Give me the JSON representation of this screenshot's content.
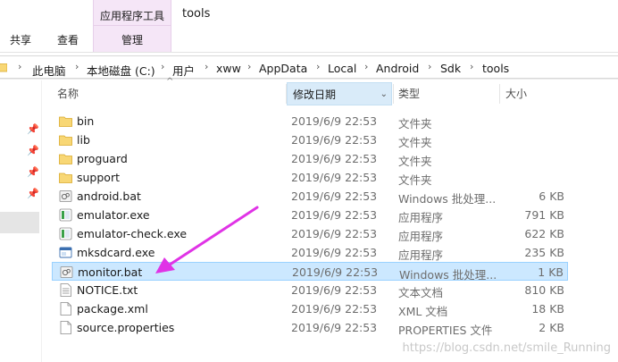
{
  "ribbon": {
    "tabs": [
      "共享",
      "查看"
    ],
    "context_group_title": "应用程序工具",
    "context_tab": "管理",
    "window_title": "tools"
  },
  "address": {
    "crumbs": [
      "此电脑",
      "本地磁盘 (C:)",
      "用户",
      "xww",
      "AppData",
      "Local",
      "Android",
      "Sdk",
      "tools"
    ]
  },
  "columns": {
    "name": "名称",
    "date": "修改日期",
    "type": "类型",
    "size": "大小"
  },
  "files": [
    {
      "name": "bin",
      "date": "2019/6/9 22:53",
      "type": "文件夹",
      "size": "",
      "icon": "folder-icon"
    },
    {
      "name": "lib",
      "date": "2019/6/9 22:53",
      "type": "文件夹",
      "size": "",
      "icon": "folder-icon"
    },
    {
      "name": "proguard",
      "date": "2019/6/9 22:53",
      "type": "文件夹",
      "size": "",
      "icon": "folder-icon"
    },
    {
      "name": "support",
      "date": "2019/6/9 22:53",
      "type": "文件夹",
      "size": "",
      "icon": "folder-icon"
    },
    {
      "name": "android.bat",
      "date": "2019/6/9 22:53",
      "type": "Windows 批处理...",
      "size": "6 KB",
      "icon": "batch-file-icon"
    },
    {
      "name": "emulator.exe",
      "date": "2019/6/9 22:53",
      "type": "应用程序",
      "size": "791 KB",
      "icon": "app-exe-icon"
    },
    {
      "name": "emulator-check.exe",
      "date": "2019/6/9 22:53",
      "type": "应用程序",
      "size": "622 KB",
      "icon": "app-exe-icon"
    },
    {
      "name": "mksdcard.exe",
      "date": "2019/6/9 22:53",
      "type": "应用程序",
      "size": "235 KB",
      "icon": "window-exe-icon"
    },
    {
      "name": "monitor.bat",
      "date": "2019/6/9 22:53",
      "type": "Windows 批处理...",
      "size": "1 KB",
      "icon": "batch-file-icon",
      "selected": true
    },
    {
      "name": "NOTICE.txt",
      "date": "2019/6/9 22:53",
      "type": "文本文档",
      "size": "810 KB",
      "icon": "text-file-icon"
    },
    {
      "name": "package.xml",
      "date": "2019/6/9 22:53",
      "type": "XML 文档",
      "size": "18 KB",
      "icon": "blank-file-icon"
    },
    {
      "name": "source.properties",
      "date": "2019/6/9 22:53",
      "type": "PROPERTIES 文件",
      "size": "2 KB",
      "icon": "blank-file-icon"
    }
  ],
  "watermark": "https://blog.csdn.net/smile_Running",
  "colors": {
    "accent_pink": "#e033e6",
    "selection_bg": "#cce8ff",
    "context_group_bg": "#f5e6f7",
    "folder_yellow": "#f8d775"
  }
}
